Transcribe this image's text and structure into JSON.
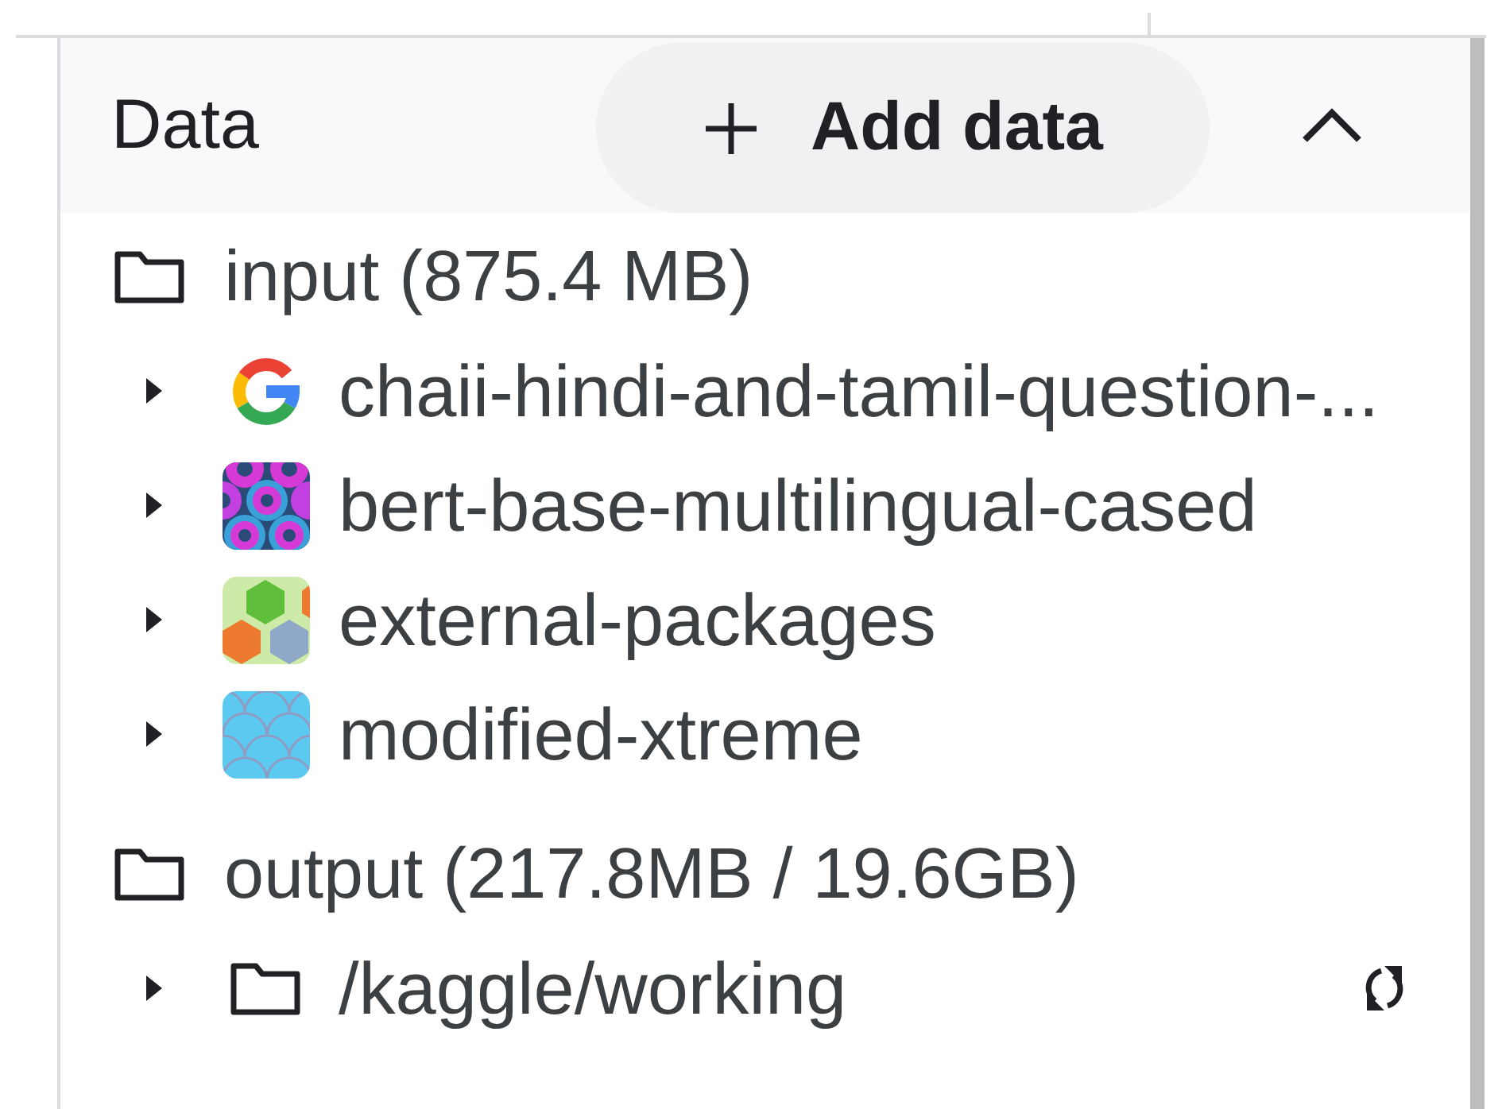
{
  "panel": {
    "title": "Data",
    "expanded": true,
    "add_button": {
      "label": "Add data"
    }
  },
  "sections": [
    {
      "label": "input (875.4 MB)",
      "items": [
        {
          "label": "chaii-hindi-and-tamil-question-...",
          "kind": "google",
          "expanded": false,
          "refresh": false
        },
        {
          "label": "bert-base-multilingual-cased",
          "kind": "scales",
          "expanded": false,
          "refresh": false
        },
        {
          "label": "external-packages",
          "kind": "hexagons",
          "expanded": false,
          "refresh": false
        },
        {
          "label": "modified-xtreme",
          "kind": "waves",
          "expanded": false,
          "refresh": false
        }
      ]
    },
    {
      "label": "output (217.8MB / 19.6GB)",
      "items": [
        {
          "label": "/kaggle/working",
          "kind": "folder",
          "expanded": false,
          "refresh": true
        }
      ]
    }
  ]
}
